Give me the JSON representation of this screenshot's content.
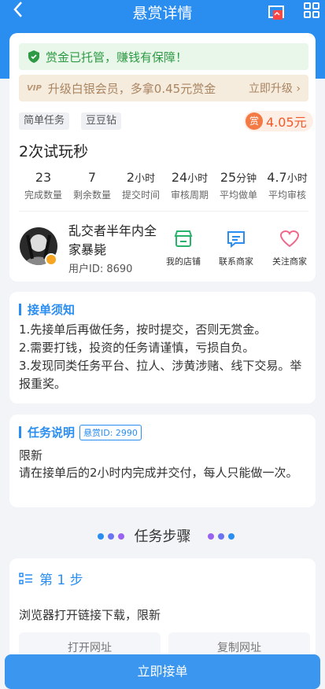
{
  "header": {
    "title": "悬赏详情"
  },
  "escrow_text": "赏金已托管，赚钱有保障！",
  "vip": {
    "tag": "VIP",
    "text": "升级白银会员，多拿0.45元赏金",
    "upgrade": "立即升级 ›"
  },
  "tags": [
    "简单任务",
    "豆豆钻"
  ],
  "reward": {
    "coin": "赏",
    "amount": "4.05元"
  },
  "task_title": "2次试玩秒",
  "stats": [
    {
      "value": "23",
      "unit": "",
      "label": "完成数量"
    },
    {
      "value": "7",
      "unit": "",
      "label": "剩余数量"
    },
    {
      "value": "2",
      "unit": "小时",
      "label": "提交时间"
    },
    {
      "value": "24",
      "unit": "小时",
      "label": "审核周期"
    },
    {
      "value": "25",
      "unit": "分钟",
      "label": "平均做单"
    },
    {
      "value": "4.7",
      "unit": "小时",
      "label": "平均审核"
    }
  ],
  "user": {
    "name": "乱交者半年内全家暴毙",
    "id": "用户ID: 8690"
  },
  "actions": [
    "我的店铺",
    "联系商家",
    "关注商家"
  ],
  "notice": {
    "title": "接单须知",
    "lines": [
      "1.先接单后再做任务，按时提交，否则无赏金。",
      "2.需要打钱，投资的任务请谨慎，亏损自负。",
      "3.发现同类任务平台、拉人、涉黄涉赌、线下交易。举报重奖。"
    ]
  },
  "description": {
    "title": "任务说明",
    "task_id": "悬赏ID: 2990",
    "line1": "限新",
    "line2": "请在接单后的2小时内完成并交付，每人只能做一次。"
  },
  "steps_title": "任务步骤",
  "step1": {
    "label": "第 1 步",
    "text": "浏览器打开链接下载，限新",
    "open": "打开网址",
    "copy": "复制网址"
  },
  "accept_button": "立即接单"
}
